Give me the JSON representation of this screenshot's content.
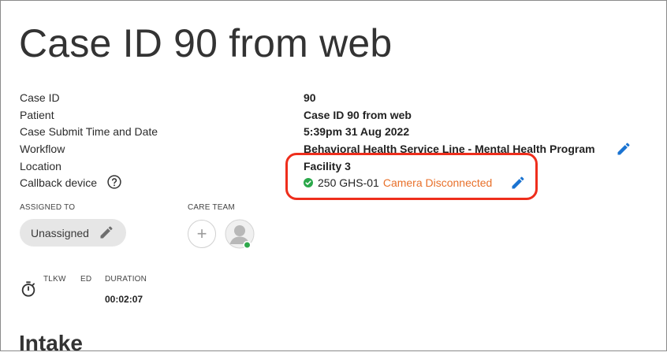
{
  "page": {
    "title": "Case ID 90 from web"
  },
  "details": {
    "rows": [
      {
        "label": "Case ID",
        "value": "90"
      },
      {
        "label": "Patient",
        "value": "Case ID 90 from web"
      },
      {
        "label": "Case Submit Time and Date",
        "value": "5:39pm 31 Aug 2022"
      },
      {
        "label": "Workflow",
        "value": "Behavioral Health Service Line - Mental Health Program"
      },
      {
        "label": "Location",
        "value": "Facility 3"
      },
      {
        "label": "Callback device",
        "value": ""
      }
    ],
    "callback": {
      "device_name": "250 GHS-01",
      "camera_status": "Camera Disconnected",
      "status_color": "#2aa84a",
      "camera_status_color": "#e8702a"
    }
  },
  "assigned": {
    "heading": "ASSIGNED TO",
    "value": "Unassigned"
  },
  "care_team": {
    "heading": "CARE TEAM",
    "member_online_color": "#2ea84b"
  },
  "timer": {
    "columns": [
      "TLKW",
      "ED",
      "DURATION"
    ],
    "duration": "00:02:07"
  },
  "sections": {
    "intake_title": "Intake"
  },
  "colors": {
    "accent": "#1a73d1",
    "highlight": "#ee2e1c"
  }
}
